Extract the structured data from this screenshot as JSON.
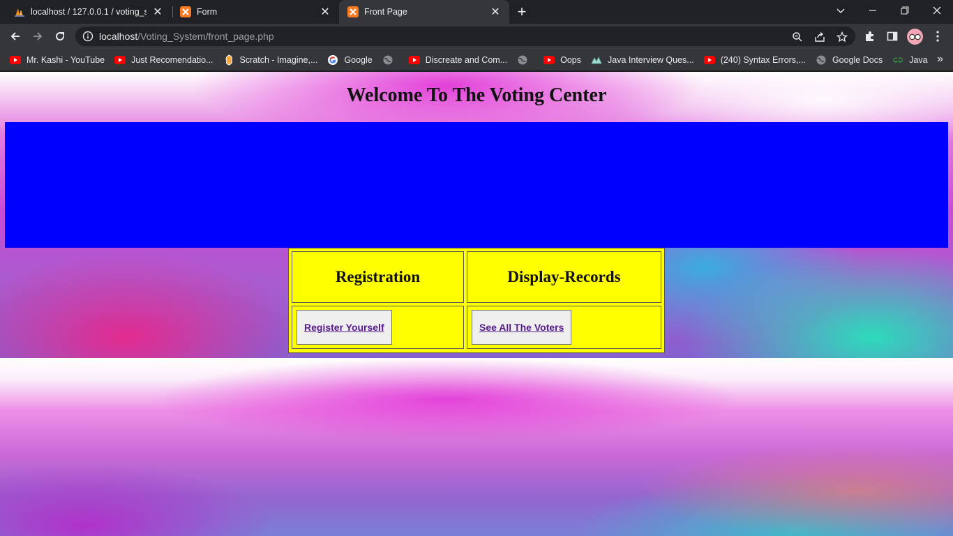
{
  "browser": {
    "tabs": [
      {
        "title": "localhost / 127.0.0.1 / voting_syst",
        "favicon": "phpmyadmin-sail-icon",
        "active": false
      },
      {
        "title": "Form",
        "favicon": "xampp-icon",
        "active": false
      },
      {
        "title": "Front Page",
        "favicon": "xampp-icon",
        "active": true
      }
    ],
    "close_glyph": "✕",
    "new_tab_glyph": "+",
    "url_host": "localhost",
    "url_path": "/Voting_System/front_page.php",
    "bookmarks": [
      {
        "label": "Mr. Kashi - YouTube",
        "icon": "youtube-icon"
      },
      {
        "label": "Just Recomendatio...",
        "icon": "youtube-icon"
      },
      {
        "label": "Scratch - Imagine,...",
        "icon": "scratch-icon"
      },
      {
        "label": "Google",
        "icon": "google-icon"
      },
      {
        "label": "",
        "icon": "globe-icon"
      },
      {
        "label": "Discreate and Com...",
        "icon": "youtube-icon"
      },
      {
        "label": "",
        "icon": "globe-icon"
      },
      {
        "label": "Oops",
        "icon": "youtube-icon"
      },
      {
        "label": "Java Interview Ques...",
        "icon": "javatpoint-icon"
      },
      {
        "label": "(240) Syntax Errors,...",
        "icon": "youtube-icon"
      },
      {
        "label": "Google Docs",
        "icon": "globe-icon"
      },
      {
        "label": "Java",
        "icon": "geeksforgeeks-icon"
      }
    ],
    "more_bookmarks_glyph": "»"
  },
  "page": {
    "heading": "Welcome To The Voting Center",
    "banner_color": "#0000ff",
    "table_color": "#ffff00",
    "columns": [
      {
        "header": "Registration",
        "button": "Register Yourself"
      },
      {
        "header": "Display-Records",
        "button": "See All The Voters"
      }
    ]
  }
}
